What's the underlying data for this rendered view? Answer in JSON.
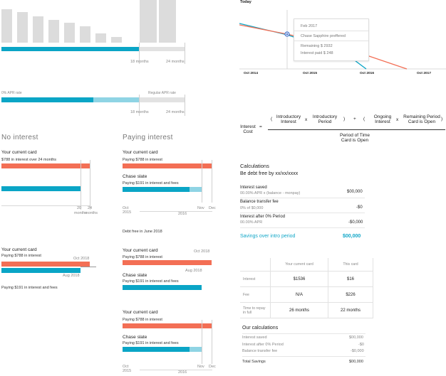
{
  "top_chart": {
    "bars": [
      0.79,
      0.72,
      0.62,
      0.54,
      0.46,
      0.38,
      0.22,
      0.13,
      1.0,
      1.0
    ],
    "label_18": "18 months",
    "label_24": "24 months"
  },
  "apr_bar": {
    "left_label": "0% APR rate",
    "right_label": "Regular APR rate",
    "label_18": "18 months",
    "label_24": "24 months"
  },
  "no_interest": {
    "heading": "No interest",
    "card_title": "Your current card",
    "card_desc": "$788 in interest over 24 months",
    "tick_20": "20",
    "tick_24": "24",
    "tick_months": "months",
    "tick_months2": "months"
  },
  "paying_interest": {
    "heading": "Paying interest",
    "card_title": "Your current card",
    "card_desc": "Paying $788 in interest",
    "slate_title": "Chase slate",
    "slate_desc": "Paying $191 in interest and fees",
    "oct": "Oct",
    "y2015": "2015",
    "nov": "Nov",
    "dec": "Dec",
    "y2016": "2016",
    "debt_free": "Debt free in June 2018"
  },
  "left_card2": {
    "title": "Your current card",
    "desc": "Paying $788 in interest",
    "oct2018": "Oct 2018",
    "aug2018": "Aug 2018",
    "fees": "Paying $191 in interest and fees"
  },
  "mid_card2": {
    "title": "Your current card",
    "desc": "Paying $788 in interest",
    "oct2018": "Oct 2018",
    "aug2018": "Aug 2018",
    "slate_title": "Chase slate",
    "slate_desc": "Paying $191 in interest and fees"
  },
  "mid_card3": {
    "title": "Your current card",
    "desc": "Paying $788 in interest",
    "slate_title": "Chase slate",
    "slate_desc": "Paying $191 in interest and fees",
    "oct": "Oct",
    "y2015": "2015",
    "nov": "Nov",
    "dec": "Dec",
    "y2016": "2016"
  },
  "line_chart": {
    "today": "Today",
    "tooltip_date": "Feb 2017",
    "tooltip_card": "Chase Sapphire preffered",
    "tooltip_remaining": "Remaining $ 2932",
    "tooltip_interest": "Interest paid $ 248",
    "x_labels": [
      "Oct 2014",
      "Oct 2015",
      "Oct 2016",
      "Oct 2017"
    ],
    "colors": {
      "orange": "#f36f55",
      "blue": "#0aa5c6"
    }
  },
  "formula": {
    "lhs": "Interest Cost",
    "eq": "=",
    "paren_open": "(",
    "intro_interest": "Introductory Interest",
    "x1": "x",
    "intro_period": "Introductory Period",
    "paren_close": ")",
    "plus": "+",
    "paren_open2": "(",
    "ongoing_interest": "Ongoing Interest",
    "x2": "x",
    "remaining_period": "Remaining Period Card is Open",
    "paren_close2": ")",
    "divisor": "Period of Time Card is Open"
  },
  "calculations": {
    "title": "Calculations",
    "debt_free": "Be debt free by xx/xx/xxxx",
    "rows": [
      {
        "label": "Interest saved",
        "sub": "00.00% APR x (balance - monpay)",
        "value": "$00,000"
      },
      {
        "label": "Balance transfer fee",
        "sub": "0% of $0,000",
        "value": "-$0"
      },
      {
        "label": "Interest after 0% Period",
        "sub": "00.00% APR",
        "value": "-$0,000"
      }
    ],
    "total_label": "Savings over intro period",
    "total_value": "$00,000"
  },
  "compare_table": {
    "headers": [
      "",
      "Your current card",
      "This card"
    ],
    "rows": [
      [
        "Interest",
        "$1536",
        "$16"
      ],
      [
        "Fee",
        "N/A",
        "$226"
      ],
      [
        "Time to repay in full",
        "26 months",
        "22 months"
      ]
    ]
  },
  "our_calcs": {
    "title": "Our calculations",
    "rows": [
      {
        "label": "Interest saved",
        "value": "$00,000"
      },
      {
        "label": "Interest after 0% Period",
        "value": "-$0"
      },
      {
        "label": "Balance transfer fee",
        "value": "-$0,000"
      }
    ],
    "total_label": "Total Savings",
    "total_value": "$00,000"
  }
}
